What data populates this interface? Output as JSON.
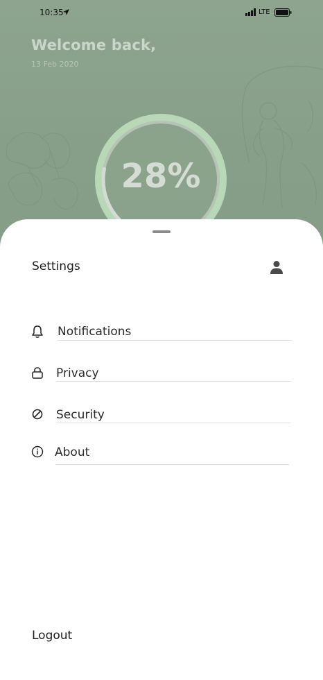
{
  "status_bar": {
    "time": "10:35",
    "network": "LTE"
  },
  "hero": {
    "greeting": "Welcome back,",
    "date": "13 Feb 2020",
    "progress_text": "28%",
    "progress_value": 0.28
  },
  "settings_sheet": {
    "title": "Settings",
    "items": [
      {
        "label": "Notifications",
        "icon": "bell-icon"
      },
      {
        "label": "Privacy",
        "icon": "lock-icon"
      },
      {
        "label": "Security",
        "icon": "slash-circle-icon"
      },
      {
        "label": "About",
        "icon": "info-icon"
      }
    ],
    "logout_label": "Logout"
  },
  "colors": {
    "hero_bg": "#8aa08a",
    "ring": "#c3e2c3",
    "sheet_bg": "#ffffff",
    "text_dark": "#1d1d1d",
    "divider": "#dcdcdc"
  }
}
